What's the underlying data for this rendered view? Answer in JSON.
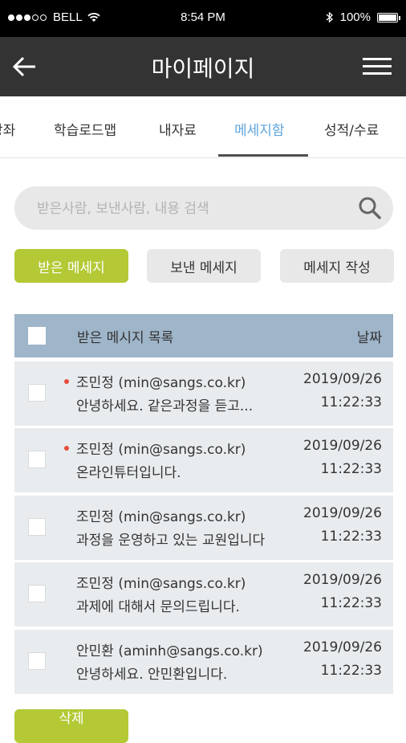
{
  "status_bar": {
    "carrier": "BELL",
    "time": "8:54 PM",
    "battery": "100%",
    "battery_level": 1.0
  },
  "header": {
    "title": "마이페이지",
    "back_icon": "arrow-left-icon",
    "menu_icon": "hamburger-menu-icon"
  },
  "tabs": [
    {
      "label": "강좌"
    },
    {
      "label": "학습로드맵"
    },
    {
      "label": "내자료"
    },
    {
      "label": "메세지함",
      "active": true
    },
    {
      "label": "성적/수료"
    }
  ],
  "search": {
    "placeholder": "받은사람, 보낸사람, 내용 검색",
    "icon": "search-icon"
  },
  "buttons": {
    "received": "받은 메세지",
    "sent": "보낸 메세지",
    "write": "메세지 작성"
  },
  "list": {
    "header_title": "받은 메시지 목록",
    "header_date": "날짜",
    "rows": [
      {
        "sender": "조민정 (min@sangs.co.kr)",
        "preview": "안녕하세요. 같은과정을 듣고...",
        "date": "2019/09/26",
        "time": "11:22:33",
        "unread": true
      },
      {
        "sender": "조민정 (min@sangs.co.kr)",
        "preview": "온라인튜터입니다.",
        "date": "2019/09/26",
        "time": "11:22:33",
        "unread": true
      },
      {
        "sender": "조민정 (min@sangs.co.kr)",
        "preview": "과정을 운영하고 있는 교원입니다",
        "date": "2019/09/26",
        "time": "11:22:33",
        "unread": false
      },
      {
        "sender": "조민정 (min@sangs.co.kr)",
        "preview": "과제에 대해서 문의드립니다.",
        "date": "2019/09/26",
        "time": "11:22:33",
        "unread": false
      },
      {
        "sender": "안민환 (aminh@sangs.co.kr)",
        "preview": "안녕하세요. 안민환입니다.",
        "date": "2019/09/26",
        "time": "11:22:33",
        "unread": false
      }
    ]
  },
  "delete_button": "삭제",
  "colors": {
    "accent_green": "#b4c935",
    "active_tab": "#5fa5dc",
    "list_header": "#9fb5c9",
    "unread_dot": "#e74c3c"
  }
}
